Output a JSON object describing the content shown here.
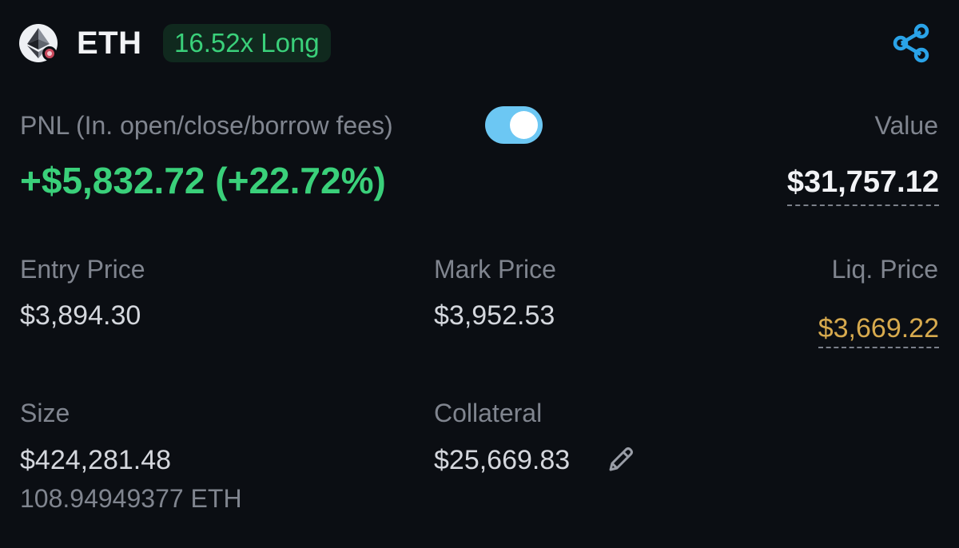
{
  "header": {
    "symbol": "ETH",
    "leverage_badge": "16.52x Long",
    "logo_icon": "ethereum-logo-icon",
    "share_icon": "share-icon"
  },
  "pnl": {
    "label": "PNL (In. open/close/borrow fees)",
    "toggle_on": true,
    "value": "+$5,832.72 (+22.72%)"
  },
  "value": {
    "label": "Value",
    "amount": "$31,757.12"
  },
  "entry_price": {
    "label": "Entry Price",
    "value": "$3,894.30"
  },
  "mark_price": {
    "label": "Mark Price",
    "value": "$3,952.53"
  },
  "liq_price": {
    "label": "Liq. Price",
    "value": "$3,669.22"
  },
  "size": {
    "label": "Size",
    "value": "$424,281.48",
    "sub_value": "108.94949377 ETH"
  },
  "collateral": {
    "label": "Collateral",
    "value": "$25,669.83",
    "edit_icon": "pencil-icon"
  },
  "colors": {
    "background": "#0b0e13",
    "positive": "#3ad07a",
    "liquidation": "#d7aa4e",
    "accent": "#2aa3e8",
    "toggle": "#6cc7f3"
  }
}
